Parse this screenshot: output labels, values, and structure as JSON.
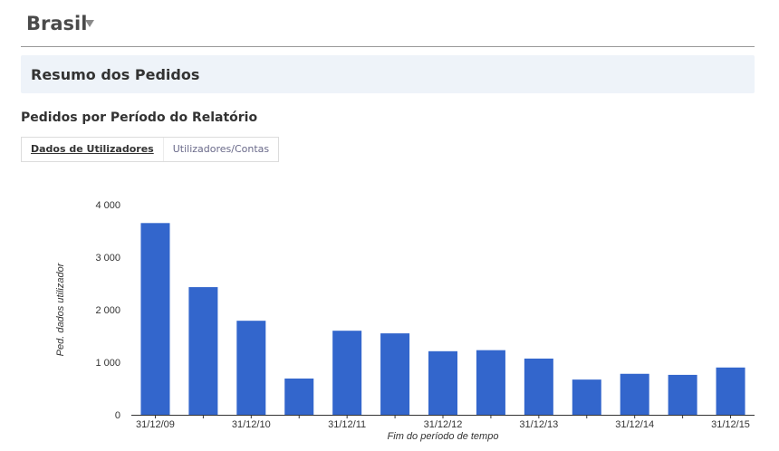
{
  "header": {
    "title": "Brasil",
    "dropdown_icon": "chevron-down-icon"
  },
  "summary": {
    "title": "Resumo dos Pedidos"
  },
  "section": {
    "heading": "Pedidos por Período do Relatório"
  },
  "tabs": [
    {
      "label": "Dados de Utilizadores",
      "active": true
    },
    {
      "label": "Utilizadores/Contas",
      "active": false
    }
  ],
  "chart_data": {
    "type": "bar",
    "categories": [
      "31/12/09",
      "",
      "31/12/10",
      "",
      "31/12/11",
      "",
      "31/12/12",
      "",
      "31/12/13",
      "",
      "31/12/14",
      "",
      "31/12/15"
    ],
    "values": [
      3650,
      2430,
      1790,
      690,
      1600,
      1550,
      1210,
      1230,
      1070,
      670,
      780,
      760,
      900
    ],
    "ylim": [
      0,
      4000
    ],
    "yticks": [
      0,
      1000,
      2000,
      3000,
      4000
    ],
    "ytick_labels": [
      "0",
      "1 000",
      "2 000",
      "3 000",
      "4 000"
    ],
    "xlabel": "Fim do período de tempo",
    "ylabel": "Ped. dados utilizador",
    "bar_color": "#3366cc",
    "grid": false
  }
}
